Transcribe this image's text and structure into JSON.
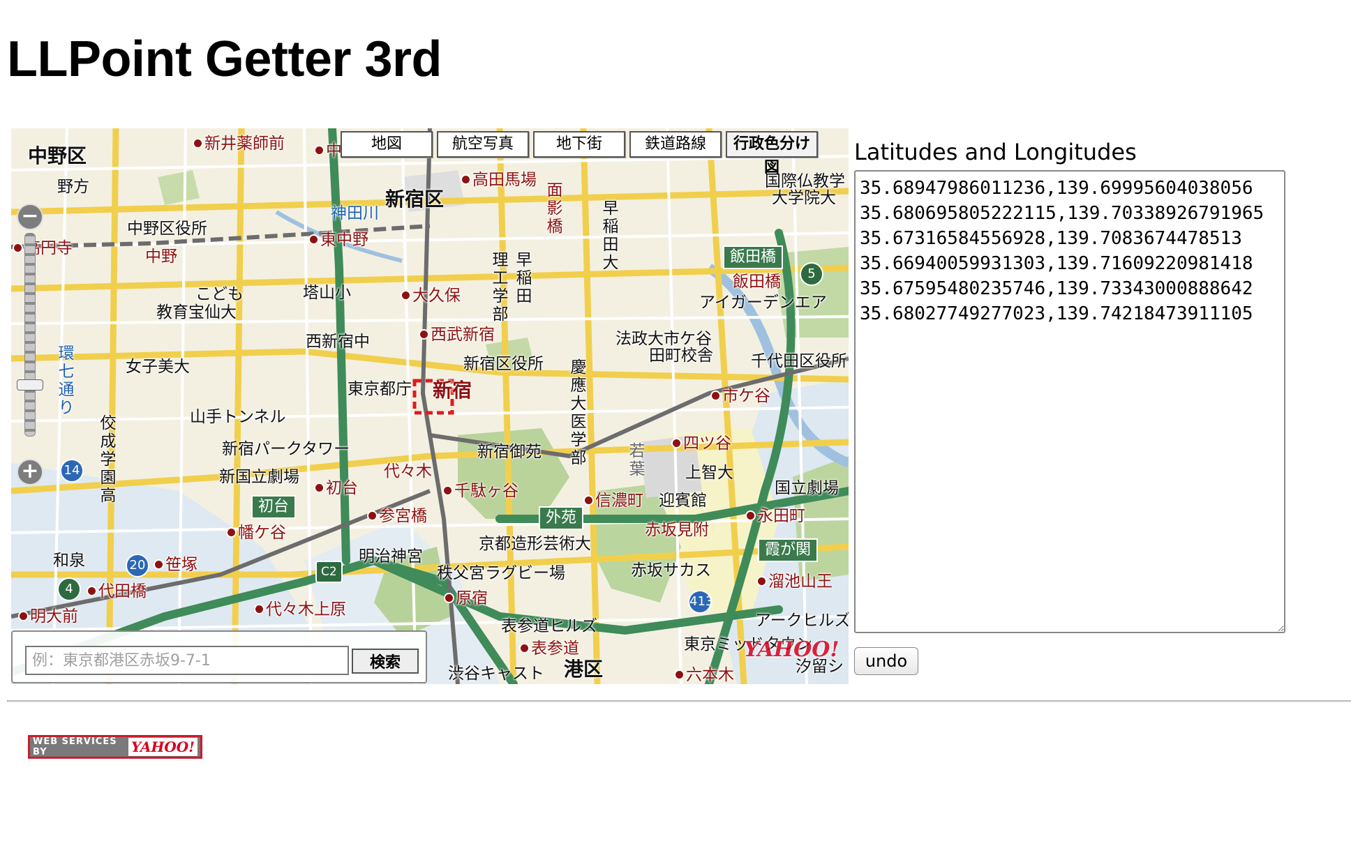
{
  "page": {
    "title": "LLPoint Getter 3rd"
  },
  "map": {
    "tabs": [
      {
        "label": "地図",
        "active": false
      },
      {
        "label": "航空写真",
        "active": false
      },
      {
        "label": "地下街",
        "active": false
      },
      {
        "label": "鉄道路線",
        "active": false
      },
      {
        "label": "行政色分け図",
        "active": true
      }
    ],
    "zoom_out_label": "−",
    "zoom_in_label": "+",
    "search": {
      "placeholder": "例：東京都港区赤坂9-7-1",
      "value": "",
      "button_label": "検索"
    },
    "logo_text": "YAHOO!",
    "labels": {
      "nakano_ku": "中野区",
      "shinjuku_ku": "新宿区",
      "minato_ku": "港区",
      "araisakushimae": "新井薬師前",
      "takadanobaba": "高田馬場",
      "nakano_kuyakusho": "中野区役所",
      "higashi_nakano": "東中野",
      "koenji": "高円寺",
      "nakano": "中野",
      "nogata": "野方",
      "kodomo": "こども",
      "kyoiku_takara": "教育宝仙大",
      "tonoyama": "塔山小",
      "okubo": "大久保",
      "seibu_shinjuku": "西武新宿",
      "nishishinjuku_chu": "西新宿中",
      "shinjuku_kuyakusho": "新宿区役所",
      "joshibi": "女子美大",
      "tokyo_tocho": "東京都庁",
      "shinjuku": "新宿",
      "yamate_tunnel": "山手トンネル",
      "park_tower": "新宿パークタワー",
      "shinkokuritsu": "新国立劇場",
      "hatsudai_badge": "初台",
      "hatsudai": "初台",
      "yoyogi": "代々木",
      "sendagaya": "千駄ヶ谷",
      "sangubashi": "参宮橋",
      "hatagaya": "幡ケ谷",
      "meiji_jingu": "明治神宮",
      "sasazuka": "笹塚",
      "izumi": "和泉",
      "yoyogi_uehara": "代々木上原",
      "daitabashi": "代田橋",
      "meidaimae": "明大前",
      "shinjuku_gyoen": "新宿御苑",
      "shinanomachi": "信濃町",
      "gaien_badge": "外苑",
      "geigei": "迎賓館",
      "kyoto_zokei": "京都造形芸術大",
      "chichibunomiya": "秩父宮ラグビー場",
      "harajuku": "原宿",
      "omotesando_hills": "表参道ヒルズ",
      "omotesando": "表参道",
      "shibuya_cast": "渋谷キャスト",
      "akasaka_sacas": "赤坂サカス",
      "akasaka_mitsuke": "赤坂見附",
      "tokyo_midtown": "東京ミッドタウン",
      "roppongi": "六本木",
      "ark_hills": "アークヒルズ",
      "tameike_sanno": "溜池山王",
      "kasumigaseki_badge": "霞が関",
      "nagatacho": "永田町",
      "kokuritsu_gekijo": "国立劇場",
      "sophia": "上智大",
      "yotsuya": "四ツ谷",
      "ichigaya": "市ケ谷",
      "hosei": "法政大市ケ谷",
      "hosei2": "田町校舎",
      "chiyoda_kuyakusho": "千代田区役所",
      "iidabashi_badge": "飯田橋",
      "iidabashi": "飯田橋",
      "agaden": "アイガーデンエア",
      "kokusai_bukkyo": "国際仏教学",
      "daigakuin": "大学院大",
      "waseda": "早稲田大",
      "riko": "理工学部",
      "waseda_kan": "早稲田",
      "omokagebashi": "面影橋",
      "keio_med": "慶應大医学部",
      "wakaba": "若葉",
      "kanda_gawa": "神田川",
      "kannana": "環七通り",
      "seijo": "佼成学園高",
      "shiodome": "汐留シ",
      "nakano_saka": "中"
    },
    "route_shields": [
      "14",
      "20",
      "4",
      "5",
      "C2",
      "413"
    ]
  },
  "coordinates_panel": {
    "label": "Latitudes and Longitudes",
    "value": "35.68947986011236,139.69995604038056\n35.680695805222115,139.70338926791965\n35.67316584556928,139.7083674478513\n35.66940059931303,139.71609220981418\n35.67595480235746,139.73343000888642\n35.68027749277023,139.74218473911105",
    "undo_label": "undo"
  },
  "footer": {
    "credit_prefix": "WEB SERVICES BY",
    "credit_brand": "YAHOO!"
  }
}
